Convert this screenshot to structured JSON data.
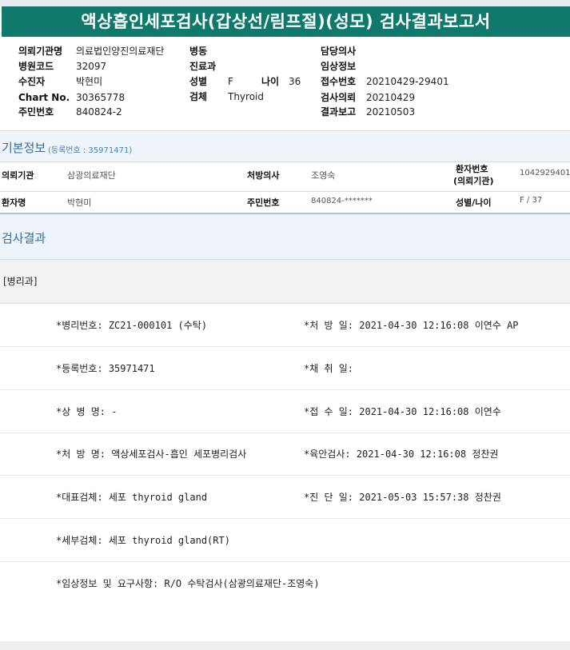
{
  "title": "액상흡인세포검사(갑상선/림프절)(성모) 검사결과보고서",
  "header_info": {
    "institution_label": "의뢰기관명",
    "institution": "의료법인양진의료재단",
    "ward_label": "병동",
    "ward": "",
    "doctor_label": "담당의사",
    "doctor": "",
    "hospital_code_label": "병원코드",
    "hospital_code": "32097",
    "dept_label": "진료과",
    "dept": "",
    "clinical_info_label": "임상정보",
    "clinical_info": "",
    "patient_label": "수진자",
    "patient": "박현미",
    "sex_label": "성별",
    "sex": "F",
    "age_label": "나이",
    "age": "36",
    "receipt_label": "접수번호",
    "receipt": "20210429-29401",
    "chart_label": "Chart No.",
    "chart": "30365778",
    "specimen_label": "검체",
    "specimen": "Thyroid",
    "request_label": "검사의뢰",
    "request_date": "20210429",
    "id_label": "주민번호",
    "id": "840824-2",
    "report_label": "결과보고",
    "report_date": "20210503"
  },
  "basic_info": {
    "title": "기본정보",
    "reg_no": "(등록번호 : 35971471)",
    "row1": {
      "inst_label": "의뢰기관",
      "inst": "삼광의료재단",
      "doctor_label": "처방의사",
      "doctor": "조영숙",
      "pid_label_1": "환자번호",
      "pid_label_2": "(의뢰기관)",
      "pid": "1042929401"
    },
    "row2": {
      "name_label": "환자명",
      "name": "박현미",
      "rrn_label": "주민번호",
      "rrn": "840824-*******",
      "sexage_label": "성별/나이",
      "sexage": "F / 37"
    }
  },
  "results": {
    "title": "검사결과",
    "department": "[병리과]",
    "rows": [
      {
        "left": "*병리번호: ZC21-000101 (수탁)",
        "right": "*처 방 일: 2021-04-30 12:16:08  이연수 AP"
      },
      {
        "left": "*등록번호: 35971471",
        "right": "*채 취 일:"
      },
      {
        "left": "*상 병 명: -",
        "right": "*접 수 일: 2021-04-30 12:16:08  이연수"
      },
      {
        "left": "*처 방 명: 액상세포검사-흡인 세포병리검사",
        "right": "*육안검사: 2021-04-30 12:16:08  정찬권"
      },
      {
        "left": "*대표검체: 세포 thyroid gland",
        "right": "*진 단 일: 2021-05-03 15:57:38  정찬권"
      },
      {
        "left": "*세부검체: 세포 thyroid gland(RT)",
        "right": ""
      },
      {
        "left": "*임상정보 및 요구사항: R/O 수탁검사(삼광의료재단-조영숙)",
        "right": ""
      }
    ]
  }
}
